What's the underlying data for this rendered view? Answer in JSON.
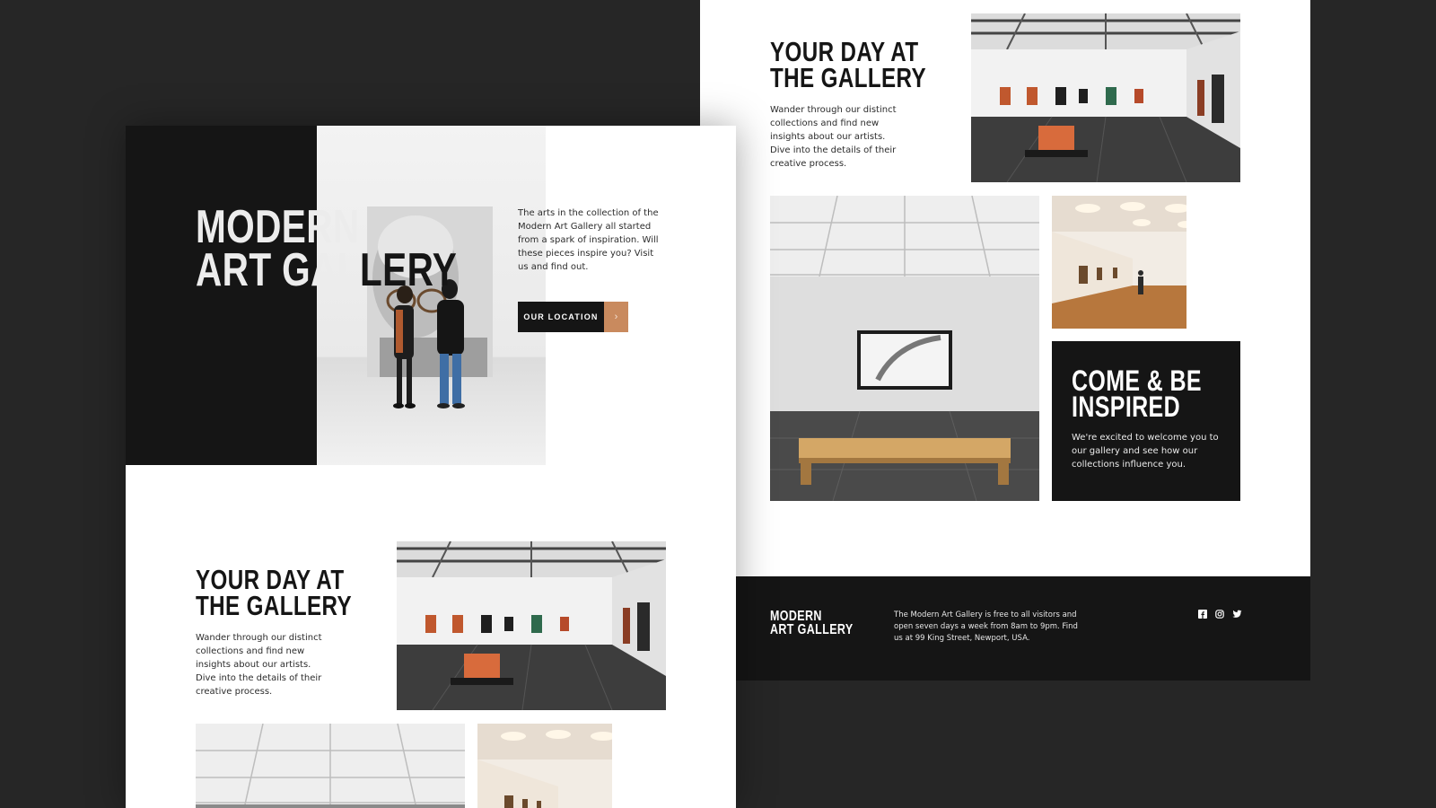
{
  "hero": {
    "title_line1": "MODERN",
    "title_line2_light": "ART GAL",
    "title_line2_dark": "LERY",
    "intro": "The arts in the collection of the Modern Art Gallery all started from a spark of inspiration. Will these pieces inspire you? Visit us and find out.",
    "location_button": "OUR LOCATION",
    "location_icon": "chevron-right-icon"
  },
  "day_section": {
    "title": "YOUR DAY AT\nTHE GALLERY",
    "text": "Wander through our distinct collections and find new insights about our artists. Dive into the details of their creative process."
  },
  "promo": {
    "title": "COME & BE\nINSPIRED",
    "text": "We're excited to welcome you to our gallery and see how our collections influence you."
  },
  "footer": {
    "brand": "MODERN\nART GALLERY",
    "text": "The Modern Art Gallery is free to all visitors and open seven days a week from 8am to 9pm. Find us at 99 King Street, Newport, USA.",
    "social_icons": [
      "facebook-icon",
      "instagram-icon",
      "twitter-icon"
    ]
  },
  "colors": {
    "background": "#262626",
    "dark": "#151515",
    "accent": "#c98a5e",
    "page": "#ffffff"
  }
}
